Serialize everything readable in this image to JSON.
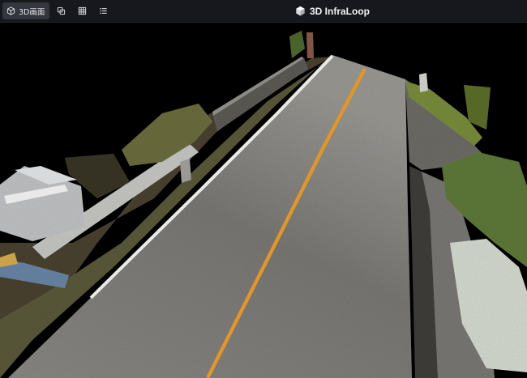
{
  "app": {
    "title": "3D InfraLoop",
    "logo_icon": "cube-logo-icon"
  },
  "toolbar": {
    "items": [
      {
        "label": "3D画面",
        "icon": "cube-outline-icon",
        "active": true
      },
      {
        "label": "",
        "icon": "layers-icon",
        "active": false
      },
      {
        "label": "",
        "icon": "grid-icon",
        "active": false
      },
      {
        "label": "",
        "icon": "list-icon",
        "active": false
      }
    ]
  },
  "colors": {
    "background": "#000000",
    "topbar": "#16181d",
    "active_button": "#33363e",
    "road_asphalt": "#7d7c79",
    "centerline": "#e0962a",
    "edge_line": "#e8e8e8",
    "vegetation": "#6a7a35"
  }
}
